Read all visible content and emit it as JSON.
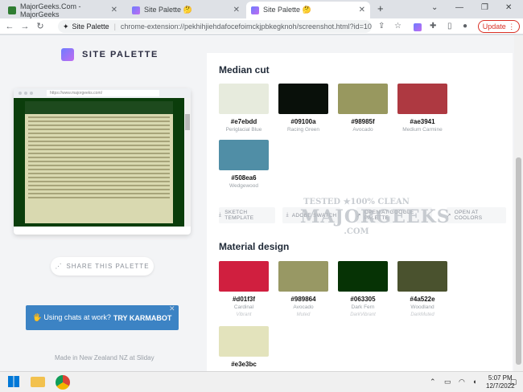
{
  "browser": {
    "tabs": [
      {
        "title": "MajorGeeks.Com - MajorGeeks",
        "active": false
      },
      {
        "title": "Site Palette 🤔",
        "active": false
      },
      {
        "title": "Site Palette 🤔",
        "active": true
      }
    ],
    "new_tab": "+",
    "site_name": "Site Palette",
    "url": "chrome-extension://pekhihjiehdafocefoimckjpbkegknoh/screenshot.html?id=101",
    "update_label": "Update"
  },
  "sidebar": {
    "logo_text": "SITE PALETTE",
    "preview_url": "https://www.majorgeeks.com/",
    "share_label": "SHARE THIS PALETTE",
    "karma_prefix": "🖐 Using chats at work?",
    "karma_cta": "TRY KARMABOT",
    "footer": "Made in New Zealand NZ at Sliday"
  },
  "median_cut": {
    "title": "Median cut",
    "swatches": [
      {
        "hex": "#e7ebdd",
        "name": "Periglacial Blue",
        "color": "#e7ebdd"
      },
      {
        "hex": "#09100a",
        "name": "Racing Green",
        "color": "#09100a"
      },
      {
        "hex": "#98985f",
        "name": "Avocado",
        "color": "#98985f"
      },
      {
        "hex": "#ae3941",
        "name": "Medium Carmine",
        "color": "#ae3941"
      },
      {
        "hex": "#508ea6",
        "name": "Wedgewood",
        "color": "#508ea6"
      }
    ],
    "actions": [
      "SKETCH TEMPLATE",
      "ADOBE SWATCH",
      "OPEN AT GOOGLE PALETTE",
      "OPEN AT COOLORS"
    ]
  },
  "material": {
    "title": "Material design",
    "swatches": [
      {
        "hex": "#d01f3f",
        "name": "Cardinal",
        "alt": "Vibrant",
        "color": "#d01f3f"
      },
      {
        "hex": "#989864",
        "name": "Avocado",
        "alt": "Muted",
        "color": "#989864"
      },
      {
        "hex": "#063305",
        "name": "Dark Fern",
        "alt": "DarkVibrant",
        "color": "#063305"
      },
      {
        "hex": "#4a522e",
        "name": "Woodland",
        "alt": "DarkMuted",
        "color": "#4a522e"
      },
      {
        "hex": "#e3e3bc",
        "name": "",
        "alt": "",
        "color": "#e3e3bc"
      }
    ]
  },
  "watermark": {
    "line1": "TESTED ★100% CLEAN",
    "line2": "MAJORGEEKS",
    "line3": ".COM"
  },
  "taskbar": {
    "time": "5:07 PM",
    "date": "12/7/2022"
  }
}
